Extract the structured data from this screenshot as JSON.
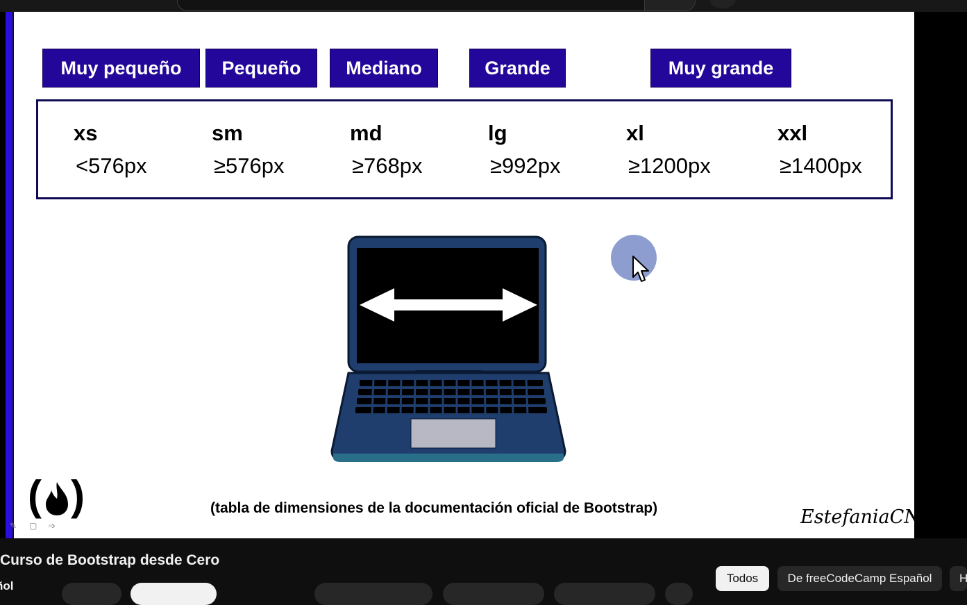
{
  "sizes": [
    {
      "label": "Muy pequeño"
    },
    {
      "label": "Pequeño"
    },
    {
      "label": "Mediano"
    },
    {
      "label": "Grande"
    },
    {
      "label": "Muy grande"
    }
  ],
  "breakpoints": [
    {
      "key": "xs",
      "value": "<576px"
    },
    {
      "key": "sm",
      "value": "≥576px"
    },
    {
      "key": "md",
      "value": "≥768px"
    },
    {
      "key": "lg",
      "value": "≥992px"
    },
    {
      "key": "xl",
      "value": "≥1200px"
    },
    {
      "key": "xxl",
      "value": "≥1400px"
    }
  ],
  "caption": "(tabla de dimensiones de la documentación oficial de Bootstrap)",
  "signature": "EstefaniaCN",
  "logo_text": "( )",
  "video": {
    "title": "Curso de Bootstrap desde Cero",
    "channel": "ñol"
  },
  "chips": [
    {
      "label": "Todos"
    },
    {
      "label": "De freeCodeCamp Español"
    },
    {
      "label": "H"
    }
  ],
  "colors": {
    "label_bg": "#22079a",
    "table_border": "#100a55",
    "laptop_body": "#1f3e6e",
    "accent_bar": "#2a0ee0"
  },
  "icons": {
    "laptop": "laptop-icon",
    "arrows": "double-arrow-icon",
    "cursor": "mouse-cursor-icon",
    "flame": "flame-icon"
  }
}
